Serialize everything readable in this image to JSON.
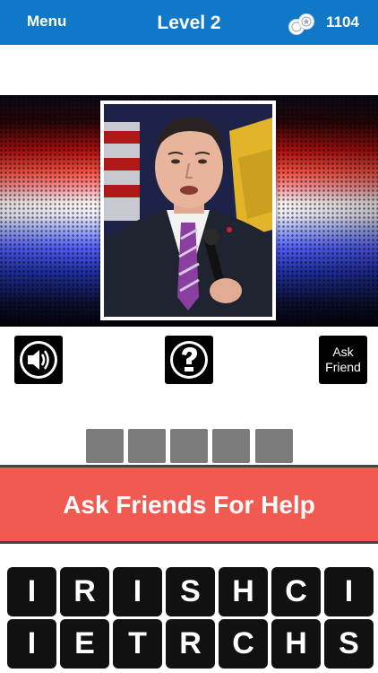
{
  "header": {
    "menu_label": "Menu",
    "title": "Level 2",
    "coins": "1104",
    "coins_icon": "coins-icon",
    "background_color": "#0f78c8"
  },
  "photo": {
    "icon": "portrait-photo"
  },
  "hints": {
    "sound_icon": "speaker-icon",
    "question_icon": "question-icon",
    "ask_friend_label_line1": "Ask",
    "ask_friend_label_line2": "Friend"
  },
  "answer": {
    "slots": [
      "",
      "",
      "",
      "",
      ""
    ]
  },
  "ask_bar": {
    "label": "Ask Friends For Help",
    "color": "#f05a50"
  },
  "keyboard": {
    "row1": [
      "I",
      "R",
      "I",
      "S",
      "H",
      "C",
      "I"
    ],
    "row2": [
      "I",
      "E",
      "T",
      "R",
      "C",
      "H",
      "S"
    ]
  }
}
